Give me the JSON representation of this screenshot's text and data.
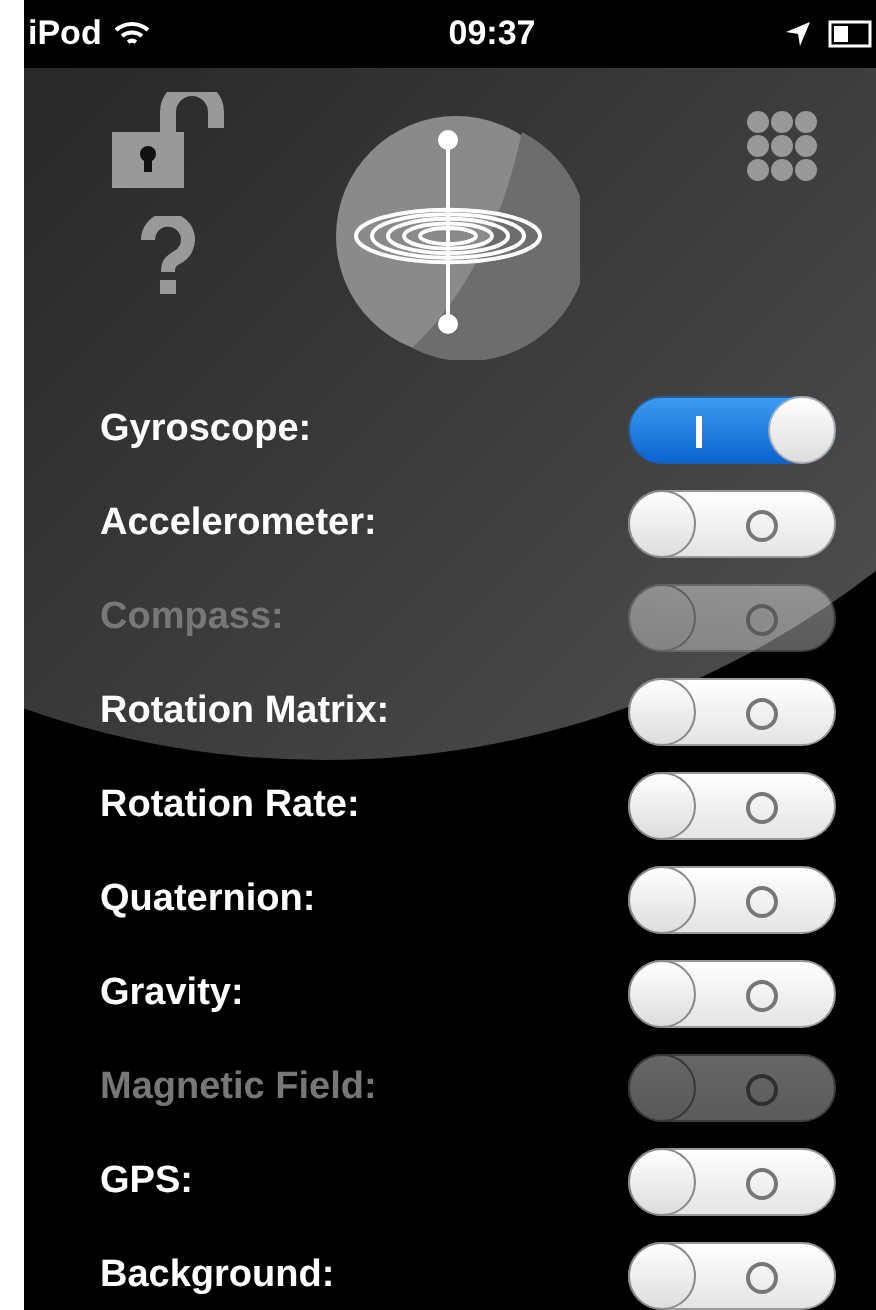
{
  "status_bar": {
    "carrier": "iPod",
    "time": "09:37"
  },
  "settings": [
    {
      "label": "Gyroscope:",
      "on": true,
      "disabled": false
    },
    {
      "label": "Accelerometer:",
      "on": false,
      "disabled": false
    },
    {
      "label": "Compass:",
      "on": false,
      "disabled": true
    },
    {
      "label": "Rotation Matrix:",
      "on": false,
      "disabled": false
    },
    {
      "label": "Rotation Rate:",
      "on": false,
      "disabled": false
    },
    {
      "label": "Quaternion:",
      "on": false,
      "disabled": false
    },
    {
      "label": "Gravity:",
      "on": false,
      "disabled": false
    },
    {
      "label": "Magnetic Field:",
      "on": false,
      "disabled": true
    },
    {
      "label": "GPS:",
      "on": false,
      "disabled": false
    },
    {
      "label": "Background:",
      "on": false,
      "disabled": false
    }
  ]
}
